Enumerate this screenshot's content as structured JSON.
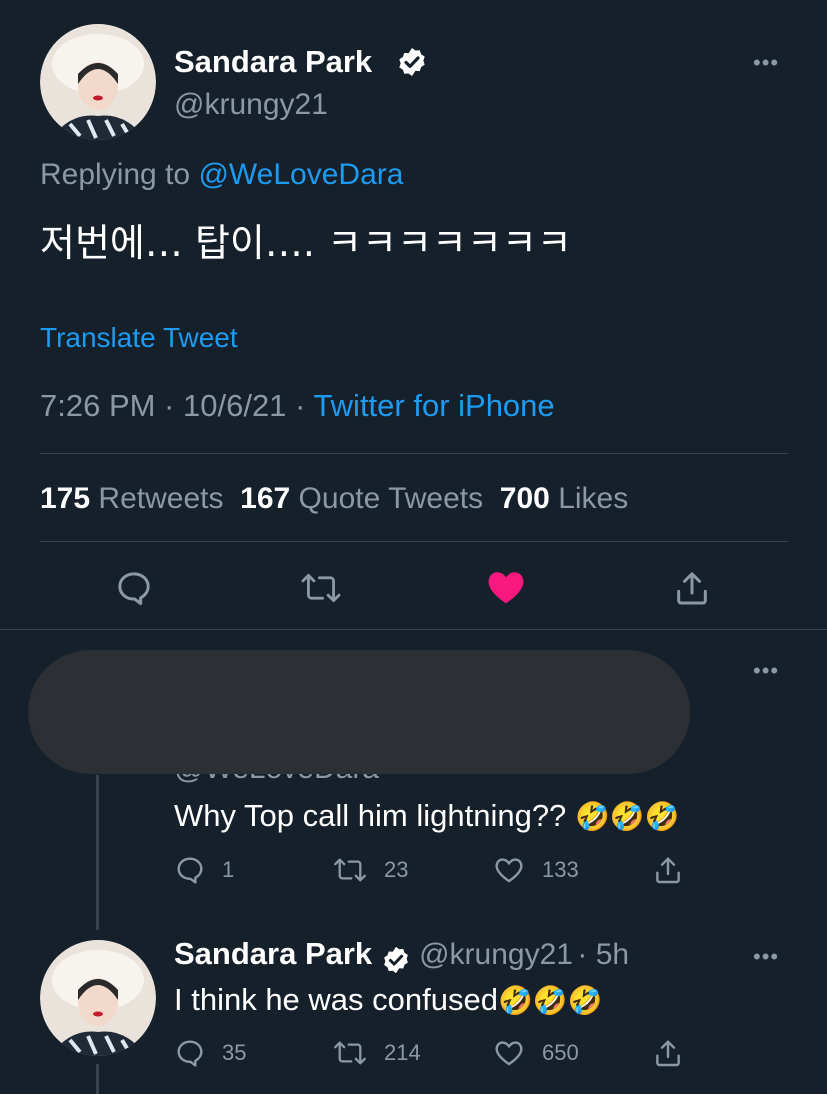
{
  "main_tweet": {
    "author_name": "Sandara Park",
    "handle": "@krungy21",
    "replying_prefix": "Replying to",
    "replying_to": "@WeLoveDara",
    "text": "저번에… 탑이…. ㅋㅋㅋㅋㅋㅋㅋ",
    "translate_label": "Translate Tweet",
    "time": "7:26 PM · 10/6/21 ·",
    "source": "Twitter for iPhone",
    "stats": {
      "retweets_count": "175",
      "retweets_label": "Retweets",
      "quotes_count": "167",
      "quotes_label": "Quote Tweets",
      "likes_count": "700",
      "likes_label": "Likes"
    }
  },
  "reply_1": {
    "partial_line": "@WeLoveDara",
    "text": "Why Top call him lightning??",
    "emojis": "🤣🤣🤣",
    "reply_count": "1",
    "retweet_count": "23",
    "like_count": "133"
  },
  "reply_2": {
    "author_name": "Sandara Park",
    "handle": "@krungy21",
    "time": "· 5h",
    "text": "I think he was confused",
    "emojis": "🤣🤣🤣",
    "reply_count": "35",
    "retweet_count": "214",
    "like_count": "650"
  },
  "icons": {
    "more": "more-icon",
    "verified": "verified-badge-icon",
    "reply": "reply-icon",
    "retweet": "retweet-icon",
    "like": "heart-icon",
    "share": "share-icon"
  },
  "colors": {
    "background": "#15202b",
    "accent": "#1d9bf0",
    "like": "#f91880",
    "secondary_text": "#8b98a5",
    "divider": "#38444d"
  }
}
